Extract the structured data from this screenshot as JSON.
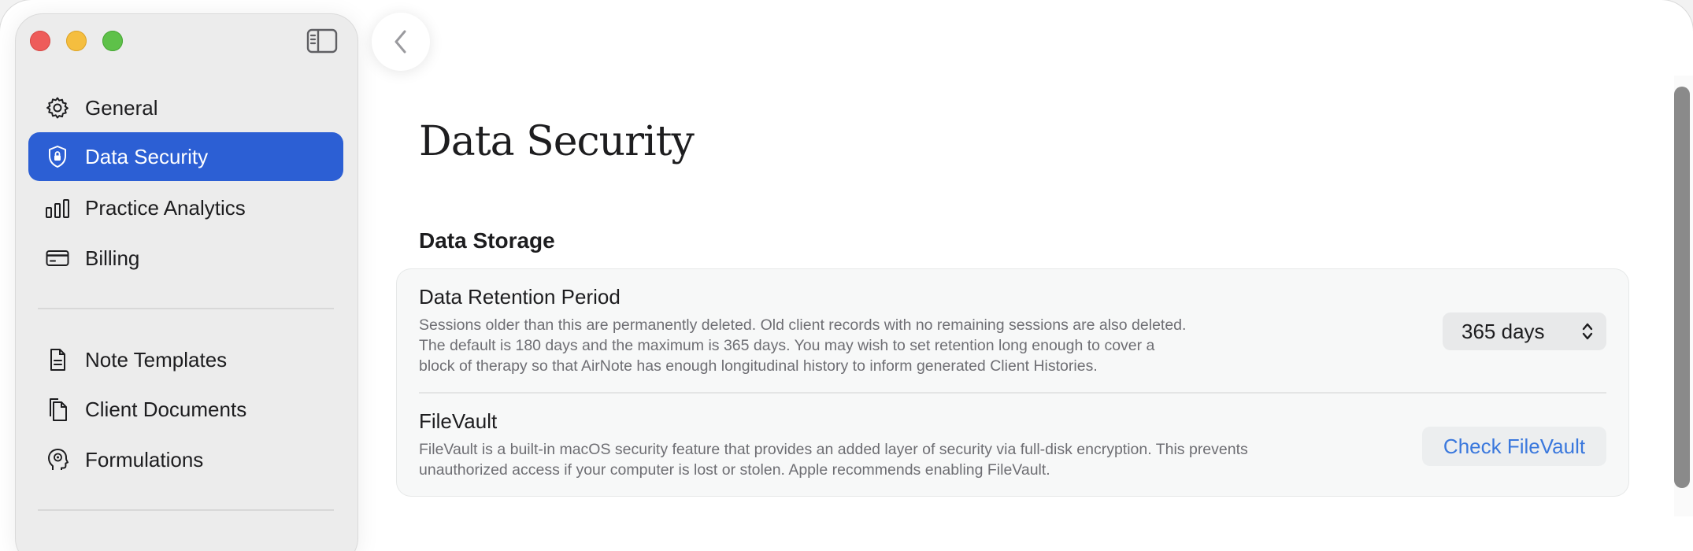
{
  "window": {
    "colors": {
      "accent": "#2c5fd4",
      "link": "#3a78dd",
      "close": "#ee5c5a",
      "minimize": "#f5be3f",
      "zoom": "#5ec149"
    }
  },
  "sidebar": {
    "toggle_icon": "sidebar-left-icon",
    "items": [
      {
        "label": "General",
        "icon": "gear-icon",
        "active": false
      },
      {
        "label": "Data Security",
        "icon": "shield-lock-icon",
        "active": true
      },
      {
        "label": "Practice Analytics",
        "icon": "bar-chart-icon",
        "active": false
      },
      {
        "label": "Billing",
        "icon": "credit-card-icon",
        "active": false
      },
      {
        "label": "Note Templates",
        "icon": "document-icon",
        "active": false
      },
      {
        "label": "Client Documents",
        "icon": "documents-icon",
        "active": false
      },
      {
        "label": "Formulations",
        "icon": "head-profile-icon",
        "active": false
      }
    ]
  },
  "toolbar": {
    "back_icon": "chevron-left-icon"
  },
  "main": {
    "title": "Data Security",
    "section": {
      "title": "Data Storage",
      "rows": [
        {
          "title": "Data Retention Period",
          "description_lines": [
            "Sessions older than this are permanently deleted. Old client records with no remaining sessions are also deleted.",
            "The default is 180 days and the maximum is 365 days. You may wish to set retention long enough to cover a",
            "block of therapy so that AirNote has enough longitudinal history to inform generated Client Histories."
          ],
          "control": {
            "type": "select",
            "value": "365 days",
            "icon": "chevron-up-down-icon"
          }
        },
        {
          "title": "FileVault",
          "description_lines": [
            "FileVault is a built-in macOS security feature that provides an added layer of security via full-disk encryption. This prevents",
            "unauthorized access if your computer is lost or stolen. Apple recommends enabling FileVault."
          ],
          "control": {
            "type": "button",
            "label": "Check FileVault"
          }
        }
      ]
    }
  }
}
